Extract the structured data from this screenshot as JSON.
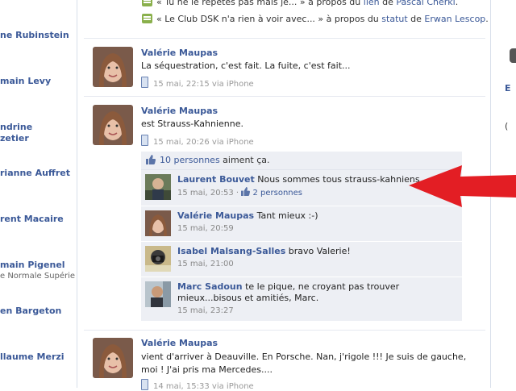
{
  "left_sidebar": {
    "names": [
      {
        "name": "ne Rubinstein"
      },
      {
        "name": "main Levy"
      },
      {
        "name": "ndrine",
        "line2": "zetier"
      },
      {
        "name": "rianne Auffret"
      },
      {
        "name": "rent Macaire"
      },
      {
        "name": "main Pigenel",
        "sub": "e Normale Supérie"
      },
      {
        "name": "en Bargeton"
      },
      {
        "name": "llaume Merzi"
      }
    ]
  },
  "top_items": [
    {
      "pre": "« Tu ne le répètes pas mais je... » à propos du ",
      "link": "lien",
      "mid": " de ",
      "person": "Pascal Cherki",
      "post": "."
    },
    {
      "pre": "« Le Club DSK n'a rien à voir avec... » à propos du ",
      "link": "statut",
      "mid": " de ",
      "person": "Erwan Lescop",
      "post": "."
    }
  ],
  "stories": [
    {
      "author": "Valérie Maupas",
      "text": "La séquestration, c'est fait. La fuite, c'est fait...",
      "time": "15 mai, 22:15",
      "via": "via iPhone"
    },
    {
      "author": "Valérie Maupas",
      "text": "est Strauss-Kahnienne.",
      "time": "15 mai, 20:26",
      "via": "via iPhone"
    },
    {
      "author": "Valérie Maupas",
      "text": "vient d'arriver à Deauville. En Porsche. Nan, j'rigole !!! Je suis de gauche, moi ! J'ai pris ma Mercedes....",
      "time": "14 mai, 15:33",
      "via": "via iPhone"
    }
  ],
  "likes": {
    "link": "10 personnes",
    "text": " aiment ça."
  },
  "comments": [
    {
      "author": "Laurent Bouvet",
      "text": "Nous sommes tous strauss-kahniens.",
      "time": "15 mai, 20:53",
      "likes": "2 personnes"
    },
    {
      "author": "Valérie Maupas",
      "text": "Tant mieux :-)",
      "time": "15 mai, 20:59"
    },
    {
      "author": "Isabel Malsang-Salles",
      "text": "bravo Valerie!",
      "time": "15 mai, 21:00"
    },
    {
      "author": "Marc Sadoun",
      "text": "te le pique, ne croyant pas trouver mieux...bisous et amitiés, Marc.",
      "time": "15 mai, 23:27"
    }
  ],
  "right_fragments": [
    "E",
    "("
  ],
  "colors": {
    "link": "#3b5998",
    "ufi_bg": "#edeff4",
    "arrow": "#e31e24"
  }
}
